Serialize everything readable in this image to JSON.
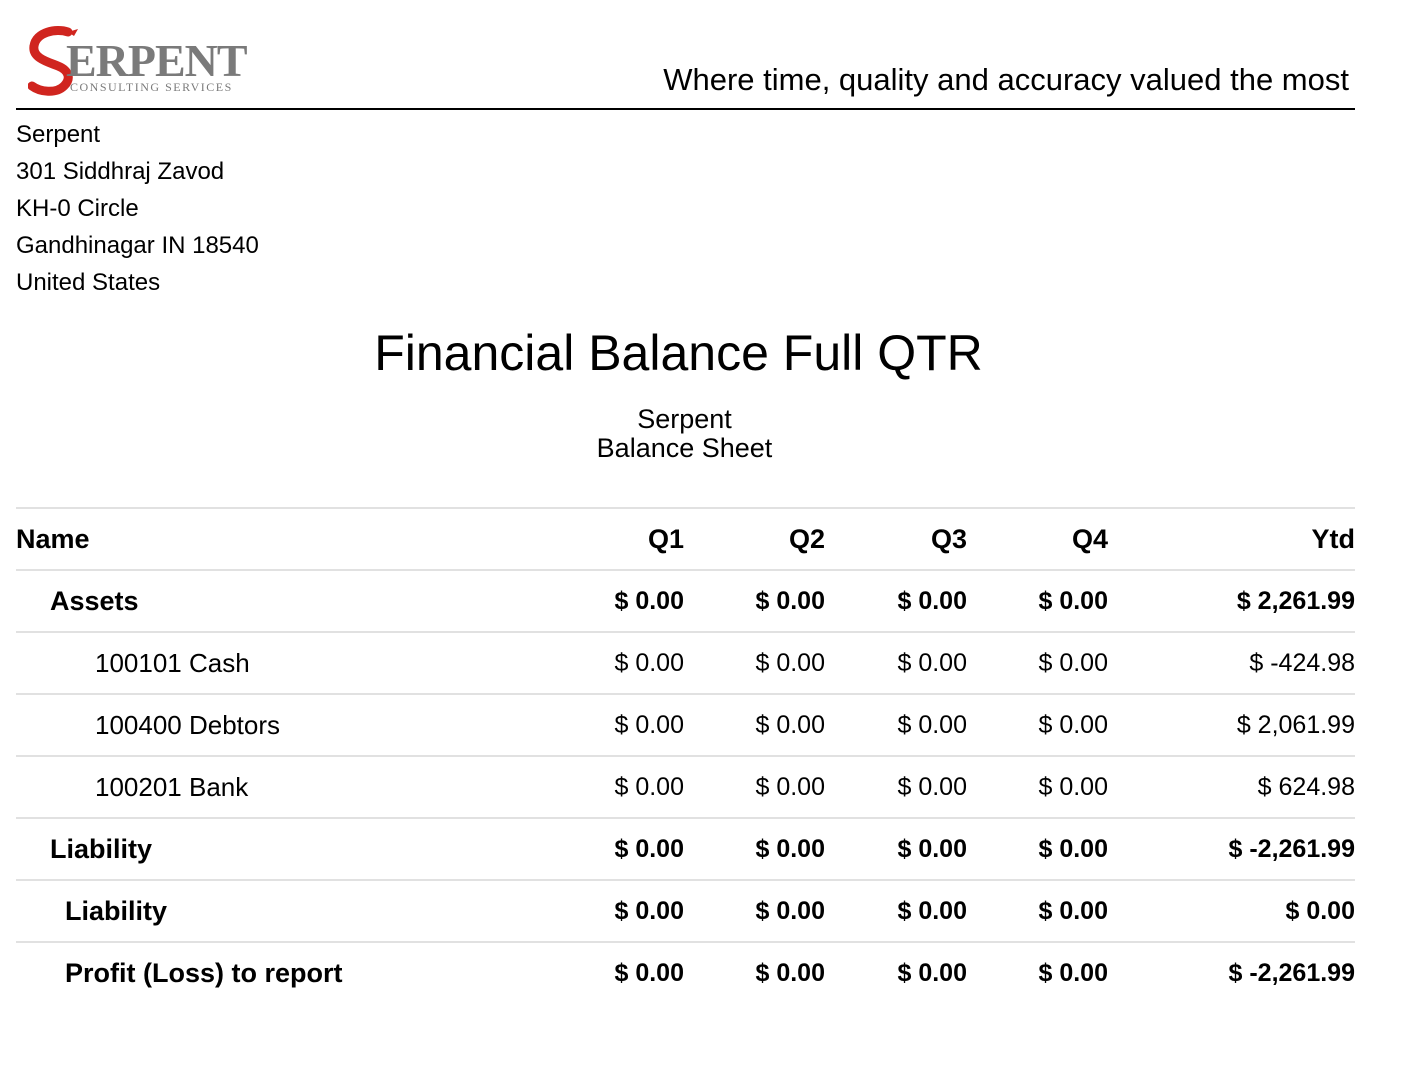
{
  "header": {
    "logo": {
      "brand": "SERPENT",
      "subtitle": "CONSULTING SERVICES",
      "brand_color": "#7a7a7a",
      "accent_color": "#d0251f"
    },
    "tagline": "Where time, quality and accuracy valued the most"
  },
  "address": {
    "lines": [
      "Serpent",
      "301 Siddhraj Zavod",
      "KH-0 Circle",
      "Gandhinagar IN 18540",
      "United States"
    ]
  },
  "report": {
    "title": "Financial Balance Full QTR",
    "company": "Serpent",
    "subtitle": "Balance Sheet"
  },
  "table": {
    "columns": [
      "Name",
      "Q1",
      "Q2",
      "Q3",
      "Q4",
      "Ytd"
    ],
    "rows": [
      {
        "name": "Assets",
        "q1": "$ 0.00",
        "q2": "$ 0.00",
        "q3": "$ 0.00",
        "q4": "$ 0.00",
        "ytd": "$ 2,261.99"
      },
      {
        "name": "100101 Cash",
        "q1": "$ 0.00",
        "q2": "$ 0.00",
        "q3": "$ 0.00",
        "q4": "$ 0.00",
        "ytd": "$ -424.98"
      },
      {
        "name": "100400 Debtors",
        "q1": "$ 0.00",
        "q2": "$ 0.00",
        "q3": "$ 0.00",
        "q4": "$ 0.00",
        "ytd": "$ 2,061.99"
      },
      {
        "name": "100201 Bank",
        "q1": "$ 0.00",
        "q2": "$ 0.00",
        "q3": "$ 0.00",
        "q4": "$ 0.00",
        "ytd": "$ 624.98"
      },
      {
        "name": "Liability",
        "q1": "$ 0.00",
        "q2": "$ 0.00",
        "q3": "$ 0.00",
        "q4": "$ 0.00",
        "ytd": "$ -2,261.99"
      },
      {
        "name": "Liability",
        "q1": "$ 0.00",
        "q2": "$ 0.00",
        "q3": "$ 0.00",
        "q4": "$ 0.00",
        "ytd": "$ 0.00"
      },
      {
        "name": "Profit (Loss) to report",
        "q1": "$ 0.00",
        "q2": "$ 0.00",
        "q3": "$ 0.00",
        "q4": "$ 0.00",
        "ytd": "$ -2,261.99"
      }
    ]
  }
}
